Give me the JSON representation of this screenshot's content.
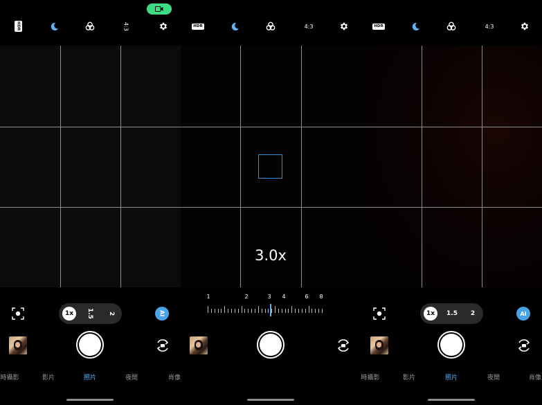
{
  "topbar": {
    "panels": [
      {
        "hdr_label": "HDR",
        "ratio": "4:3"
      },
      {
        "hdr_label": "HDR",
        "ratio": "4:3"
      },
      {
        "hdr_label": "HDR",
        "ratio": "4:3"
      }
    ],
    "record_indicator_color": "#3ddc84",
    "active_icon_color": "#5fb3f2"
  },
  "viewfinder": {
    "zoom_level": "3.0x",
    "focus_box_color": "#2f8fd8"
  },
  "zoom_ruler": {
    "labels": [
      "1",
      "2",
      "3",
      "4",
      "6",
      "8"
    ],
    "current": 3.0
  },
  "left_panel": {
    "zoom_options": [
      "1x",
      "1.5",
      "2"
    ],
    "selected_zoom": "1x",
    "ai_label": "AI",
    "modes": [
      "時攝影",
      "影片",
      "照片",
      "夜間",
      "肖像"
    ],
    "active_mode": "照片"
  },
  "right_panel": {
    "zoom_options": [
      "1x",
      "1.5",
      "2"
    ],
    "selected_zoom": "1x",
    "ai_label": "AI",
    "modes": [
      "時攝影",
      "影片",
      "照片",
      "夜間",
      "肖像"
    ],
    "active_mode": "照片"
  }
}
